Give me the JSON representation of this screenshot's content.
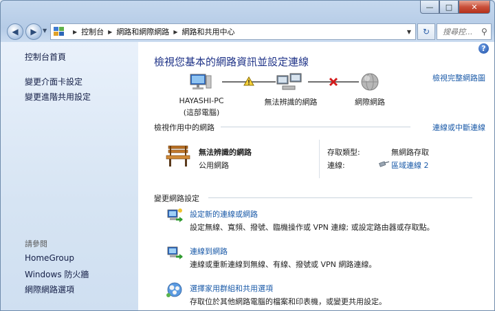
{
  "window": {
    "caption_min": "—",
    "caption_max": "□",
    "caption_close": "✕"
  },
  "address": {
    "crumbs": [
      "控制台",
      "網路和網際網路",
      "網路和共用中心"
    ],
    "search_placeholder": "搜尋控..."
  },
  "sidebar": {
    "items": [
      "控制台首頁",
      "變更介面卡設定",
      "變更進階共用設定"
    ],
    "see_also_label": "請參閱",
    "see_also": [
      "HomeGroup",
      "Windows 防火牆",
      "網際網路選項"
    ]
  },
  "main": {
    "title": "檢視您基本的網路資訊並設定連線",
    "view_full_map": "檢視完整網路圖",
    "map_nodes": [
      {
        "name": "HAYASHI-PC",
        "sub": "(這部電腦)"
      },
      {
        "name": "無法辨識的網路",
        "sub": ""
      },
      {
        "name": "網際網路",
        "sub": ""
      }
    ],
    "active_networks_label": "檢視作用中的網路",
    "connect_disconnect": "連線或中斷連線",
    "network": {
      "name": "無法辨識的網路",
      "type": "公用網路",
      "access_type_label": "存取類型:",
      "access_type_value": "無網路存取",
      "connections_label": "連線:",
      "connections_value": "區域連線 2"
    },
    "change_settings_label": "變更網路設定",
    "tasks": [
      {
        "title": "設定新的連線或網路",
        "desc": "設定無線、寬頻、撥號、臨機操作或 VPN 連線; 或設定路由器或存取點。"
      },
      {
        "title": "連線到網路",
        "desc": "連線或重新連線到無線、有線、撥號或 VPN 網路連線。"
      },
      {
        "title": "選擇家用群組和共用選項",
        "desc": "存取位於其他網路電腦的檔案和印表機，或變更共用設定。"
      }
    ]
  }
}
